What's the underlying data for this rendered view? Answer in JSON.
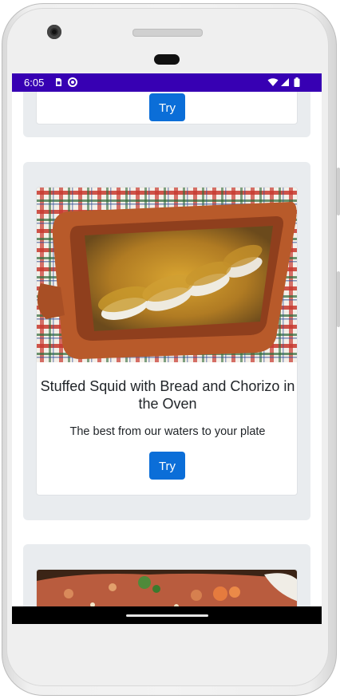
{
  "status_bar": {
    "time": "6:05",
    "background": "#3700b3"
  },
  "cards": [
    {
      "button_label": "Try"
    },
    {
      "title": "Stuffed Squid with Bread and Chorizo in the Oven",
      "description": "The best from our waters to your plate",
      "button_label": "Try",
      "image": "stuffed-squid-dish"
    },
    {
      "image": "paella-rice-dish"
    }
  ],
  "colors": {
    "accent_button": "#0b6ed8",
    "card_outer_bg": "#e9ecef",
    "status_bar": "#3700b3"
  }
}
